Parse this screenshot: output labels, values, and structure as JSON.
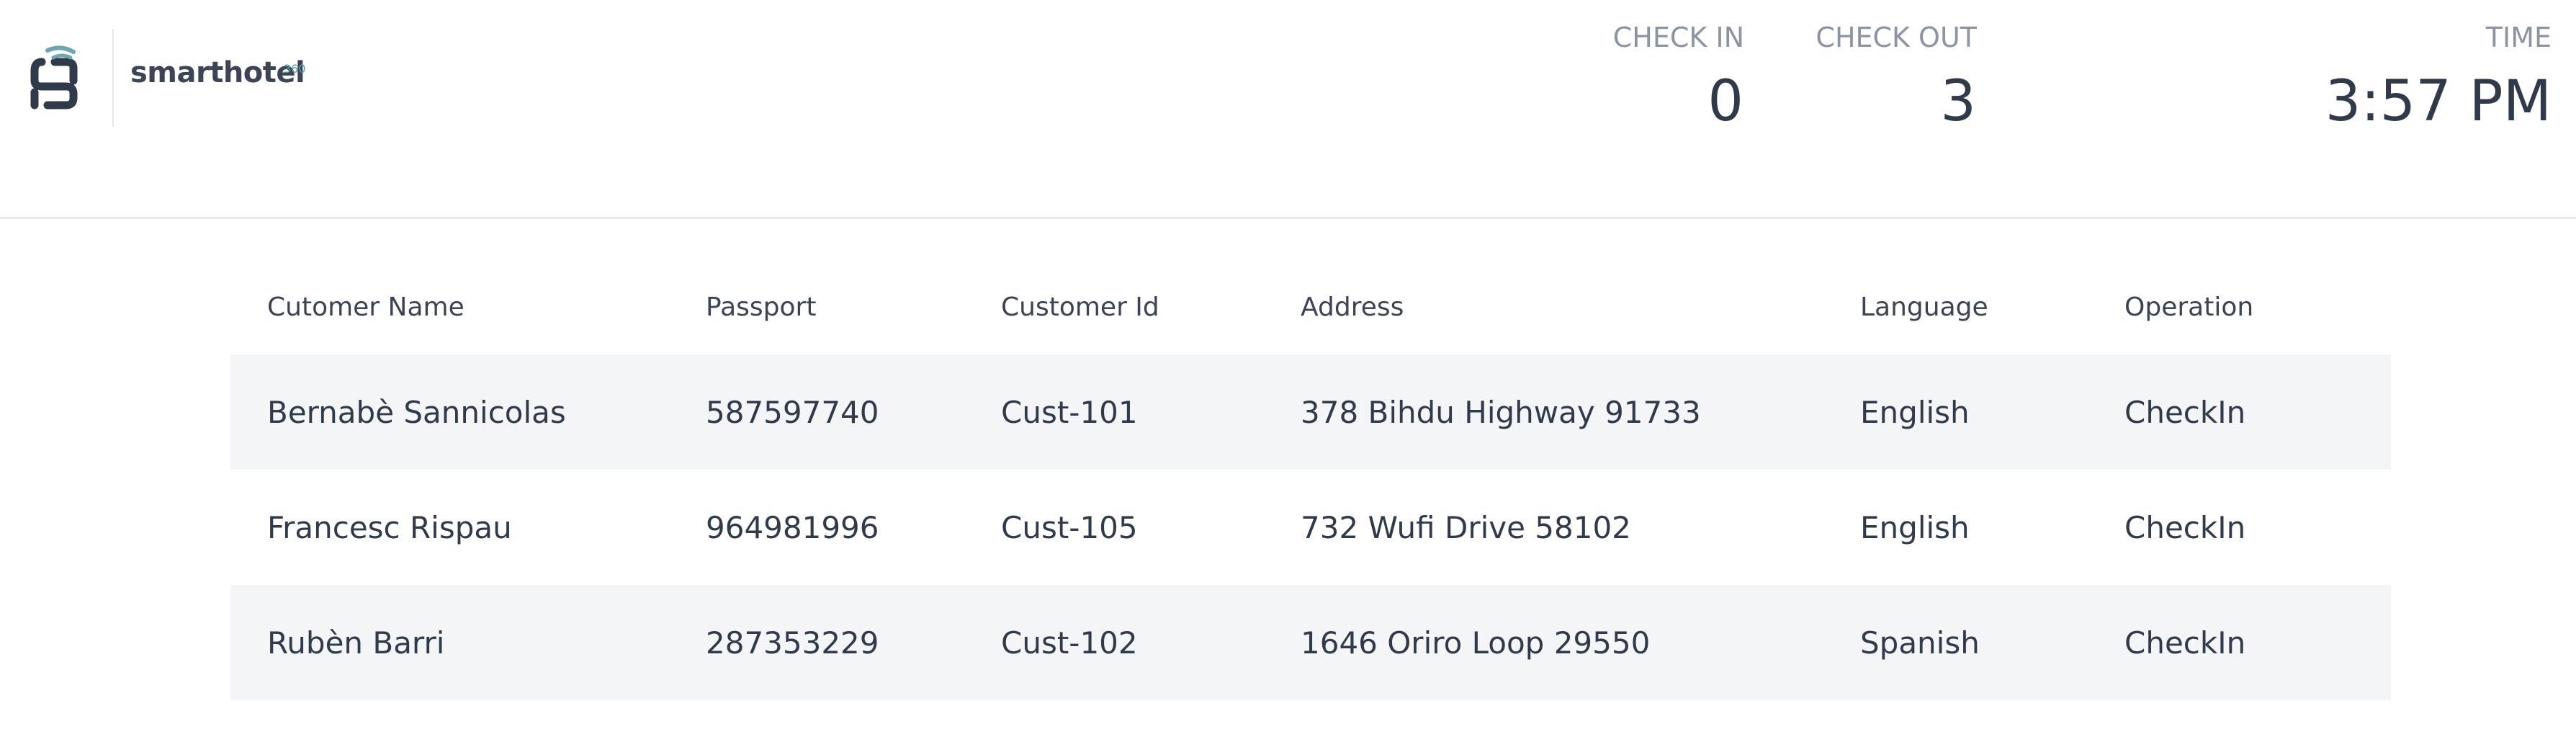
{
  "brand": {
    "name": "smarthotel",
    "superscript": "360",
    "logo_icon": "smarthotel-logo-icon"
  },
  "stats": {
    "check_in": {
      "label": "CHECK IN",
      "value": "0"
    },
    "check_out": {
      "label": "CHECK OUT",
      "value": "3"
    },
    "time": {
      "label": "TIME",
      "value": "3:57 PM"
    }
  },
  "table": {
    "columns": [
      "Cutomer Name",
      "Passport",
      "Customer Id",
      "Address",
      "Language",
      "Operation"
    ],
    "rows": [
      [
        "Bernabè Sannicolas",
        "587597740",
        "Cust-101",
        "378 Bihdu Highway 91733",
        "English",
        "CheckIn"
      ],
      [
        "Francesc Rispau",
        "964981996",
        "Cust-105",
        "732 Wufi Drive 58102",
        "English",
        "CheckIn"
      ],
      [
        "Rubèn Barri",
        "287353229",
        "Cust-102",
        "1646 Oriro Loop 29550",
        "Spanish",
        "CheckIn"
      ]
    ]
  },
  "colors": {
    "text": "#2f3a4b",
    "muted": "#8a94a2",
    "row_shade": "#f4f5f7",
    "accent": "#5a9aa8"
  }
}
